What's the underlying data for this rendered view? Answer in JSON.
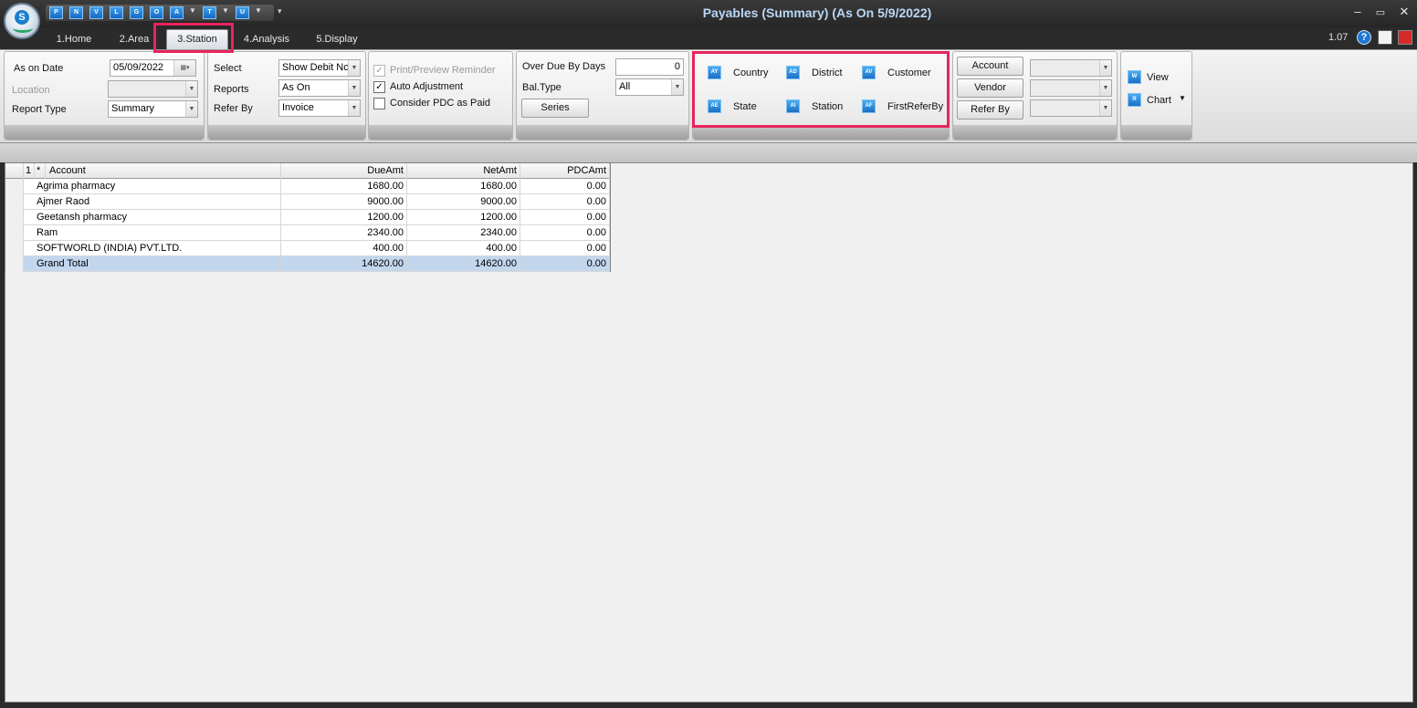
{
  "window": {
    "title": "Payables (Summary) (As On 5/9/2022)",
    "minimize_glyph": "–",
    "maximize_glyph": "▭",
    "close_glyph": "✕"
  },
  "quick_access": [
    {
      "icon": "P"
    },
    {
      "icon": "N"
    },
    {
      "icon": "V"
    },
    {
      "icon": "L"
    },
    {
      "icon": "G"
    },
    {
      "icon": "O"
    },
    {
      "icon": "A"
    },
    {
      "icon": "T"
    },
    {
      "icon": "U"
    }
  ],
  "tabs": [
    {
      "label": "1.Home"
    },
    {
      "label": "2.Area"
    },
    {
      "label": "3.Station"
    },
    {
      "label": "4.Analysis"
    },
    {
      "label": "5.Display"
    }
  ],
  "active_tab": "3.Station",
  "version": "1.07",
  "ribbon": {
    "date_group": {
      "as_on_date_label": "As on Date",
      "as_on_date_value": "05/09/2022",
      "location_label": "Location",
      "location_value": "",
      "report_type_label": "Report Type",
      "report_type_value": "Summary"
    },
    "select_group": {
      "select_label": "Select",
      "select_value": "Show Debit Nc",
      "reports_label": "Reports",
      "reports_value": "As On",
      "refer_by_label": "Refer By",
      "refer_by_value": "Invoice"
    },
    "options_group": {
      "print_preview_label": "Print/Preview Reminder",
      "print_preview_checked": true,
      "auto_adjustment_label": "Auto Adjustment",
      "auto_adjustment_checked": true,
      "consider_pdc_label": "Consider PDC as Paid",
      "consider_pdc_checked": false,
      "check_glyph": "✓"
    },
    "overdue_group": {
      "over_due_label": "Over Due By Days",
      "over_due_value": "0",
      "bal_type_label": "Bal.Type",
      "bal_type_value": "All",
      "series_button": "Series"
    },
    "area_group": {
      "country_label": "Country",
      "district_label": "District",
      "customer_label": "Customer",
      "state_label": "State",
      "station_label": "Station",
      "first_refer_by_label": "FirstReferBy"
    },
    "filter_group": {
      "account_button": "Account",
      "vendor_button": "Vendor",
      "refer_by_button": "Refer By"
    },
    "view_group": {
      "view_label": "View",
      "chart_label": "Chart"
    }
  },
  "grid": {
    "headers": {
      "rownum": "1",
      "star": "*",
      "account": "Account",
      "due_amt": "DueAmt",
      "net_amt": "NetAmt",
      "pdc_amt": "PDCAmt"
    },
    "rows": [
      {
        "account": "Agrima pharmacy",
        "due_amt": "1680.00",
        "net_amt": "1680.00",
        "pdc_amt": "0.00"
      },
      {
        "account": "Ajmer Raod",
        "due_amt": "9000.00",
        "net_amt": "9000.00",
        "pdc_amt": "0.00"
      },
      {
        "account": "Geetansh pharmacy",
        "due_amt": "1200.00",
        "net_amt": "1200.00",
        "pdc_amt": "0.00"
      },
      {
        "account": "Ram",
        "due_amt": "2340.00",
        "net_amt": "2340.00",
        "pdc_amt": "0.00"
      },
      {
        "account": "SOFTWORLD (INDIA) PVT.LTD.",
        "due_amt": "400.00",
        "net_amt": "400.00",
        "pdc_amt": "0.00"
      }
    ],
    "total": {
      "account": "Grand Total",
      "due_amt": "14620.00",
      "net_amt": "14620.00",
      "pdc_amt": "0.00"
    }
  },
  "colors": {
    "highlight": "#e8245c",
    "title_text": "#b9d7f5",
    "total_row": "#c2d6ee"
  }
}
